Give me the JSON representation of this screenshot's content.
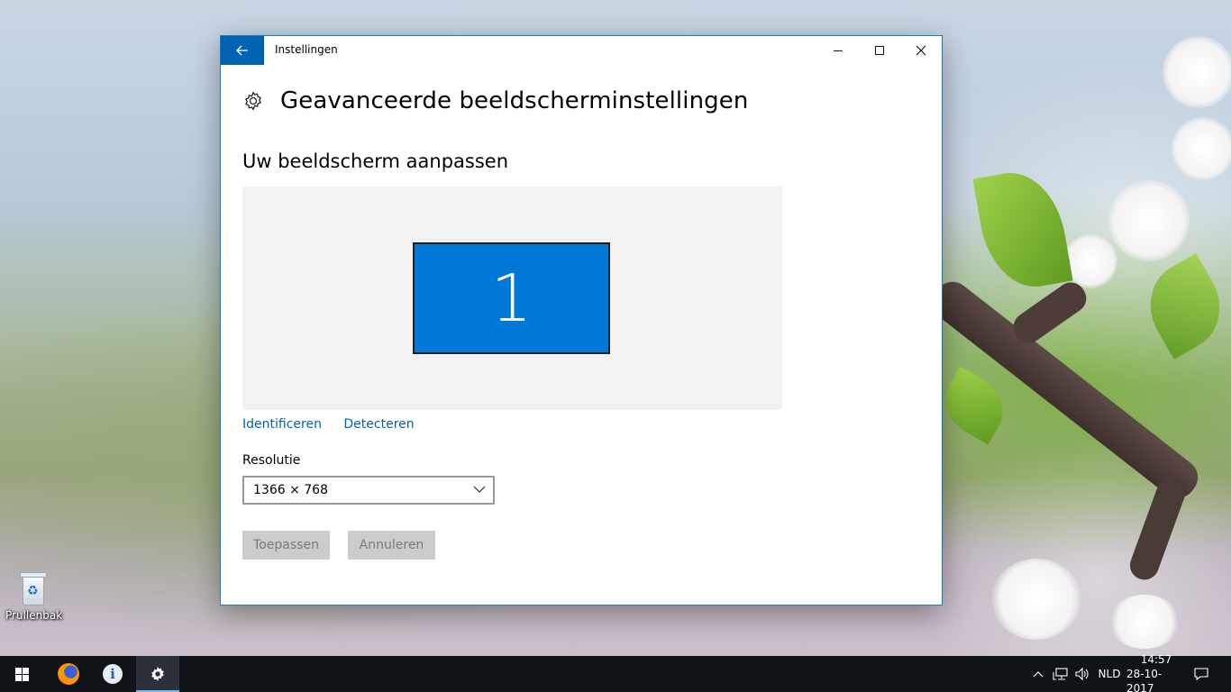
{
  "desktop": {
    "recycle_bin_label": "Prullenbak"
  },
  "window": {
    "title": "Instellingen",
    "back_icon": "arrow-left-icon",
    "controls": [
      "minimize-icon",
      "maximize-icon",
      "close-icon"
    ],
    "accent_color": "#0063b1"
  },
  "page": {
    "title": "Geavanceerde beeldscherminstellingen",
    "section_title": "Uw beeldscherm aanpassen",
    "monitor_number": "1",
    "monitor_color": "#0078d7",
    "links": {
      "identify": "Identificeren",
      "detect": "Detecteren"
    },
    "resolution_label": "Resolutie",
    "resolution_value": "1366 × 768",
    "apply_label": "Toepassen",
    "cancel_label": "Annuleren"
  },
  "taskbar": {
    "apps": [
      "windows-start-icon",
      "firefox-icon",
      "info-icon",
      "settings-gear-icon"
    ],
    "language": "NLD",
    "time": "14:57",
    "date": "28-10-2017"
  }
}
